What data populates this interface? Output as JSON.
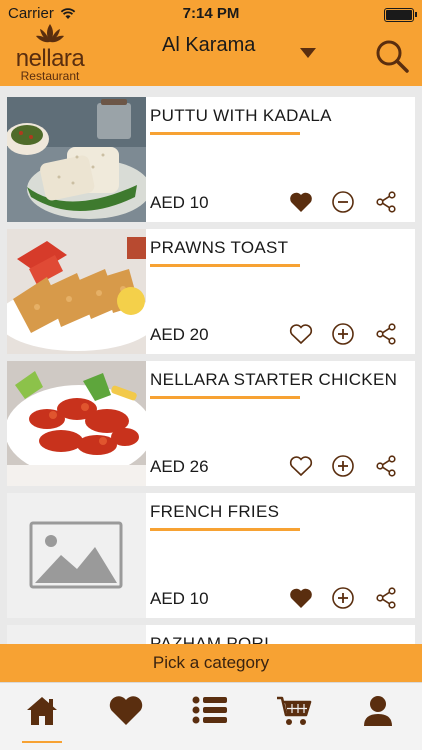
{
  "status_bar": {
    "carrier": "Carrier",
    "time": "7:14 PM"
  },
  "brand": {
    "name": "nellara",
    "subtitle": "Restaurant"
  },
  "header": {
    "location": "Al Karama"
  },
  "colors": {
    "accent": "#f7a233",
    "brown": "#5a2e0f"
  },
  "menu_items": [
    {
      "name": "PUTTU WITH KADALA",
      "price": "AED 10",
      "favorited": true,
      "in_cart": true,
      "image_caption": "Puttu with Kadala"
    },
    {
      "name": "PRAWNS TOAST",
      "price": "AED 20",
      "favorited": false,
      "in_cart": false,
      "image_caption": "Prawns Toast"
    },
    {
      "name": "NELLARA STARTER CHICKEN",
      "price": "AED 26",
      "favorited": false,
      "in_cart": false,
      "image_caption": "Nellara Starter Chicken"
    },
    {
      "name": "FRENCH FRIES",
      "price": "AED 10",
      "favorited": true,
      "in_cart": false,
      "image_caption": ""
    },
    {
      "name": "PAZHAM PORI",
      "price": "",
      "favorited": false,
      "in_cart": false,
      "image_caption": ""
    }
  ],
  "category_bar": {
    "label": "Pick a category"
  },
  "tabs": [
    {
      "icon": "home-icon",
      "active": true
    },
    {
      "icon": "heart-icon",
      "active": false
    },
    {
      "icon": "list-icon",
      "active": false
    },
    {
      "icon": "cart-icon",
      "active": false
    },
    {
      "icon": "user-icon",
      "active": false
    }
  ]
}
